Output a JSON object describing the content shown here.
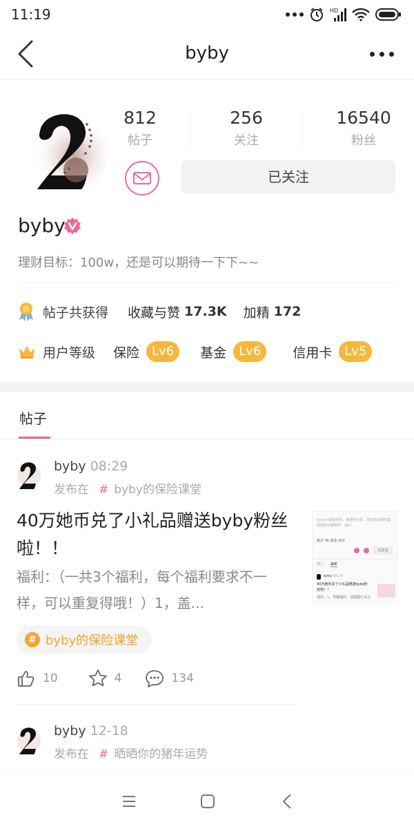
{
  "status_bar": {
    "time": "11:19",
    "icons": [
      "more-dots-icon",
      "alarm-icon",
      "signal-hd-icon",
      "wifi-icon",
      "battery-icon"
    ]
  },
  "nav": {
    "title": "byby",
    "back_icon": "back-arrow-icon",
    "more_icon": "more-icon"
  },
  "profile": {
    "stats": [
      {
        "value": "812",
        "label": "帖子"
      },
      {
        "value": "256",
        "label": "关注"
      },
      {
        "value": "16540",
        "label": "粉丝"
      }
    ],
    "message_icon": "mail-icon",
    "follow_label": "已关注",
    "name": "byby",
    "verified_icon": "verified-v-icon",
    "bio": "理财目标：100w，还是可以期待一下下~~"
  },
  "awards": {
    "label": "帖子共获得",
    "items": [
      {
        "key": "收藏与赞",
        "value": "17.3K"
      },
      {
        "key": "加精",
        "value": "172"
      }
    ]
  },
  "levels": {
    "label": "用户等级",
    "items": [
      {
        "category": "保险",
        "level": "Lv6"
      },
      {
        "category": "基金",
        "level": "Lv6"
      },
      {
        "category": "信用卡",
        "level": "Lv5"
      }
    ]
  },
  "tabs": {
    "posts_label": "帖子"
  },
  "posts": [
    {
      "author": "byby",
      "time": "08:29",
      "posted_in_label": "发布在",
      "hash": "#",
      "forum": "byby的保险课堂",
      "title": "40万她币兑了小礼品赠送byby粉丝啦！！",
      "excerpt": "福利：（一共3个福利，每个福利要求不一样，可以重复得哦！）1，盖...",
      "topic": "byby的保险课堂",
      "topic_icon": "#",
      "likes": "10",
      "stars": "4",
      "comments": "134",
      "thumb": {
        "top_text": "byby小姐姐你好，谢谢你分享，还有很多保险理财的知识我想学，请问...",
        "stats": "帖子 36  关注 410",
        "follow": "已关注",
        "tab1": "热门",
        "tab2": "最新",
        "author": "byby",
        "time": "08:29",
        "title": "40万她币兑了小礼品赠送byby粉丝啦！！",
        "excerpt": "福利：1，赞糖福利：请截图已关注"
      }
    },
    {
      "author": "byby",
      "time": "12-18",
      "posted_in_label": "发布在",
      "hash": "#",
      "forum": "晒晒你的猪年运势"
    }
  ]
}
